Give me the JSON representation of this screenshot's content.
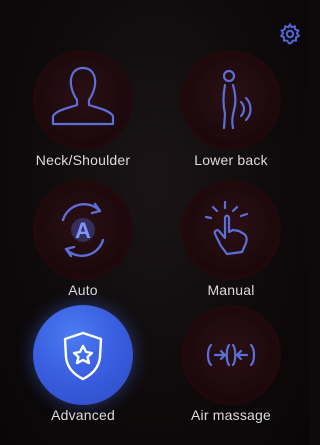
{
  "header": {
    "settings_icon": "gear-icon"
  },
  "modes": [
    {
      "label": "Neck/Shoulder",
      "icon": "head-shoulders-icon",
      "selected": false
    },
    {
      "label": "Lower back",
      "icon": "lower-back-icon",
      "selected": false
    },
    {
      "label": "Auto",
      "icon": "auto-cycle-icon",
      "selected": false
    },
    {
      "label": "Manual",
      "icon": "hand-sparkle-icon",
      "selected": false
    },
    {
      "label": "Advanced",
      "icon": "shield-star-icon",
      "selected": true
    },
    {
      "label": "Air massage",
      "icon": "air-pressure-icon",
      "selected": false
    }
  ],
  "colors": {
    "background": "#0d0a0b",
    "icon_stroke": "#5a6fd6",
    "selected": "#3a5fe0",
    "label": "#dcdcdc"
  }
}
